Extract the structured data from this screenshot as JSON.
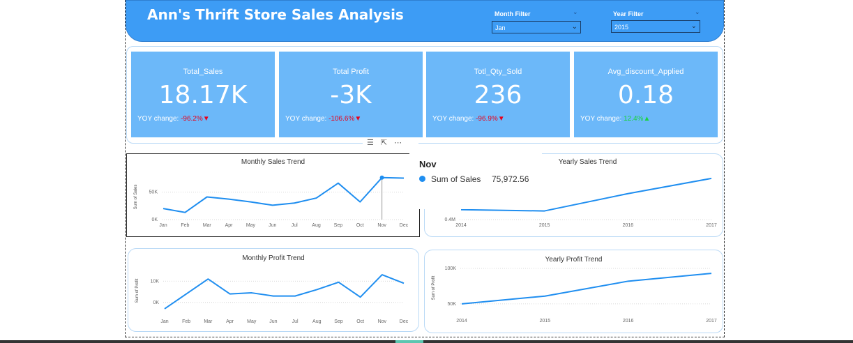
{
  "header": {
    "title": "Ann's Thrift Store Sales Analysis",
    "month_filter": {
      "label": "Month Filter",
      "value": "Jan"
    },
    "year_filter": {
      "label": "Year Filter",
      "value": "2015"
    }
  },
  "kpis": [
    {
      "label": "Total_Sales",
      "value": "18.17K",
      "yoy_label": "YOY change: ",
      "yoy_value": "-96.2%",
      "trend": "down"
    },
    {
      "label": "Total Profit",
      "value": "-3K",
      "yoy_label": "YOY change: ",
      "yoy_value": "-106.6%",
      "trend": "down"
    },
    {
      "label": "Totl_Qty_Sold",
      "value": "236",
      "yoy_label": "YOY change: ",
      "yoy_value": "-96.9%",
      "trend": "down"
    },
    {
      "label": "Avg_discount_Applied",
      "value": "0.18",
      "yoy_label": "YOY change: ",
      "yoy_value": "12.4%",
      "trend": "up"
    }
  ],
  "colors": {
    "header": "#3d9cf5",
    "kpi": "#6cb8f9",
    "line": "#1f8ef0",
    "negative": "#e8001c",
    "positive": "#18d43c"
  },
  "icons": {
    "filter": "filter-icon",
    "focus": "focus-mode-icon",
    "more": "more-options-icon"
  },
  "tooltip": {
    "title": "Nov",
    "series": "Sum of Sales",
    "value": "75,972.56"
  },
  "chart_data": [
    {
      "id": "monthly_sales",
      "type": "line",
      "title": "Monthly Sales Trend",
      "ylabel": "Sum of Sales",
      "x": [
        "Jan",
        "Feb",
        "Mar",
        "Apr",
        "May",
        "Jun",
        "Jul",
        "Aug",
        "Sep",
        "Oct",
        "Nov",
        "Dec"
      ],
      "series": [
        {
          "values": [
            20000,
            13000,
            41000,
            37000,
            32000,
            26000,
            30000,
            39000,
            66000,
            32000,
            75972.56,
            75000
          ]
        }
      ],
      "ylim": [
        0,
        82000
      ],
      "yticks": [
        {
          "v": 0,
          "label": "0K"
        },
        {
          "v": 50000,
          "label": "50K"
        }
      ],
      "highlight_index": 10
    },
    {
      "id": "yearly_sales",
      "type": "line",
      "title": "Yearly Sales Trend",
      "ylabel": "Sum of Sales",
      "x": [
        "2014",
        "2015",
        "2016",
        "2017"
      ],
      "series": [
        {
          "values": [
            480000,
            470000,
            610000,
            733000
          ]
        }
      ],
      "ylim": [
        400000,
        800000
      ],
      "yticks": [
        {
          "v": 400000,
          "label": "0.4M"
        }
      ]
    },
    {
      "id": "monthly_profit",
      "type": "line",
      "title": "Monthly Profit Trend",
      "ylabel": "Sum of Profit",
      "x": [
        "Jan",
        "Feb",
        "Mar",
        "Apr",
        "May",
        "Jun",
        "Jul",
        "Aug",
        "Sep",
        "Oct",
        "Nov",
        "Dec"
      ],
      "series": [
        {
          "values": [
            -3000,
            4000,
            11000,
            4000,
            4500,
            3000,
            3000,
            6000,
            9500,
            2500,
            13000,
            9000
          ]
        }
      ],
      "ylim": [
        -4000,
        15000
      ],
      "yticks": [
        {
          "v": 0,
          "label": "0K"
        },
        {
          "v": 10000,
          "label": "10K"
        }
      ]
    },
    {
      "id": "yearly_profit",
      "type": "line",
      "title": "Yearly Profit Trend",
      "ylabel": "Sum of Profit",
      "x": [
        "2014",
        "2015",
        "2016",
        "2017"
      ],
      "series": [
        {
          "values": [
            50000,
            61000,
            82000,
            93000
          ]
        }
      ],
      "ylim": [
        45000,
        100000
      ],
      "yticks": [
        {
          "v": 50000,
          "label": "50K"
        },
        {
          "v": 100000,
          "label": "100K"
        }
      ]
    }
  ]
}
